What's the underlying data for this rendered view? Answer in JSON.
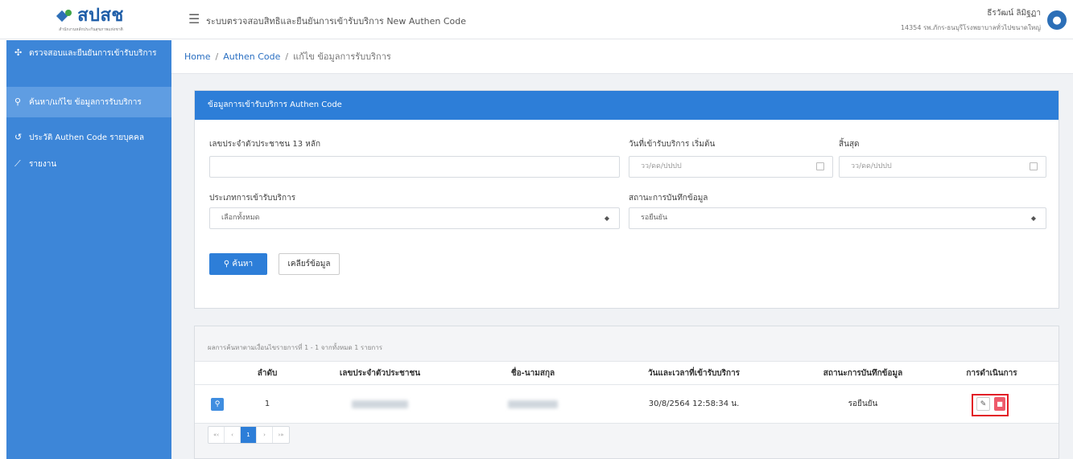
{
  "header": {
    "logo_text": "สปสช",
    "logo_sub": "สำนักงานหลักประกันสุขภาพแห่งชาติ",
    "app_title": "ระบบตรวจสอบสิทธิและยืนยันการเข้ารับบริการ New Authen Code",
    "user_name": "ธีรวัฒน์ ลิมิฐฏา",
    "user_org": "14354 รพ.ภักร-ธนบุรีโรงพยาบาลทั่วไปขนาดใหญ่",
    "menu_icon": "hamburger-icon",
    "avatar_icon": "user-icon"
  },
  "sidebar": {
    "items": [
      {
        "label": "ตรวจสอบและยืนยันการเข้ารับบริการ",
        "icon": "plus-medical-icon"
      },
      {
        "label": "ค้นหา/แก้ไข ข้อมูลการรับบริการ",
        "icon": "search-icon"
      },
      {
        "label": "ประวัติ Authen Code รายบุคคล",
        "icon": "history-icon"
      },
      {
        "label": "รายงาน",
        "icon": "chart-icon"
      }
    ]
  },
  "breadcrumb": {
    "home": "Home",
    "authen": "Authen Code",
    "current": "แก้ไข ข้อมูลการรับบริการ"
  },
  "form": {
    "title": "ข้อมูลการเข้ารับบริการ Authen Code",
    "id_label": "เลขประจำตัวประชาชน 13 หลัก",
    "id_value": "",
    "start_label": "วันที่เข้ารับบริการ เริ่มต้น",
    "start_placeholder": "วว/ดด/ปปปป",
    "end_label": "สิ้นสุด",
    "end_placeholder": "วว/ดด/ปปปป",
    "type_label": "ประเภทการเข้ารับบริการ",
    "type_value": "เลือกทั้งหมด",
    "status_label": "สถานะการบันทึกข้อมูล",
    "status_value": "รอยืนยัน",
    "search_button": "ค้นหา",
    "clear_button": "เคลียร์ข้อมูล"
  },
  "results": {
    "summary": "ผลการค้นหาตามเงื่อนไขรายการที่ 1 - 1 จากทั้งหมด 1 รายการ",
    "columns": [
      "ลำดับ",
      "เลขประจำตัวประชาชน",
      "ชื่อ-นามสกุล",
      "วันและเวลาที่เข้ารับบริการ",
      "สถานะการบันทึกข้อมูล",
      "การดำเนินการ"
    ],
    "rows": [
      {
        "no": "1",
        "citizen_id": "",
        "name": "",
        "datetime": "30/8/2564 12:58:34 น.",
        "status": "รอยืนยัน"
      }
    ],
    "pager": [
      "«‹",
      "‹",
      "1",
      "›",
      "›»"
    ]
  }
}
